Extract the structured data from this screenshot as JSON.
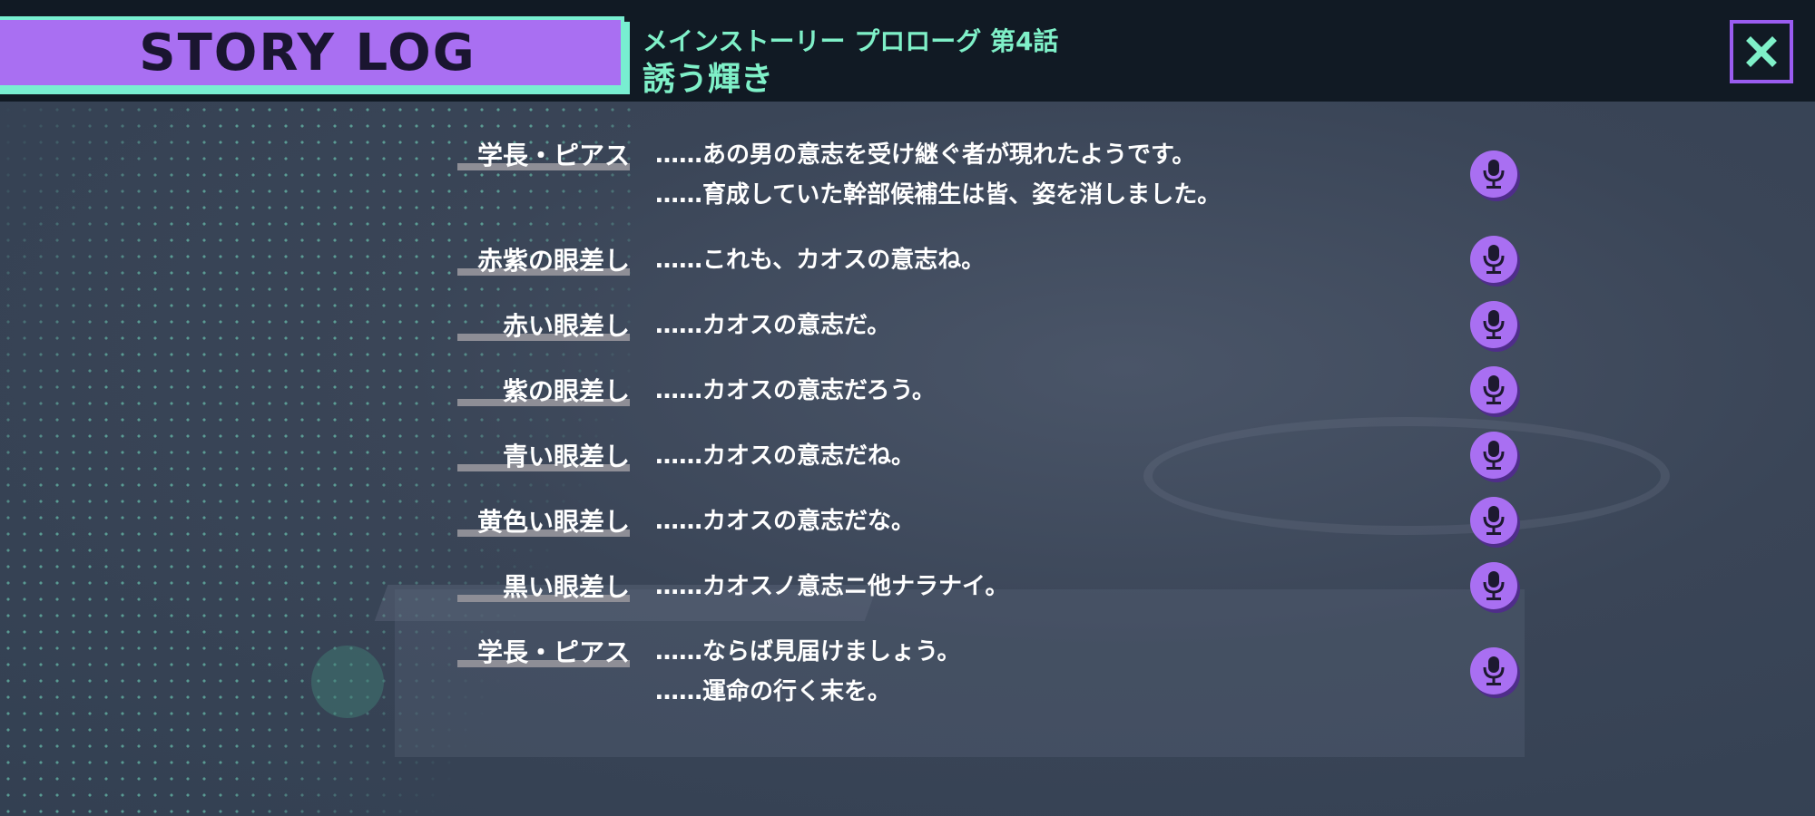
{
  "header": {
    "title": "STORY LOG",
    "subtitle": "メインストーリー プロローグ 第4話",
    "episode": "誘う輝き",
    "close_icon": "close-icon"
  },
  "colors": {
    "accent_purple": "#a96ff2",
    "accent_mint": "#78eed1",
    "header_bg": "#111a24"
  },
  "log": [
    {
      "speaker": "学長・ピアス",
      "lines": [
        "……あの男の意志を受け継ぐ者が現れたようです。",
        "……育成していた幹部候補生は皆、姿を消しました。"
      ],
      "icon": "microphone-icon"
    },
    {
      "speaker": "赤紫の眼差し",
      "lines": [
        "……これも、カオスの意志ね。"
      ],
      "icon": "microphone-icon"
    },
    {
      "speaker": "赤い眼差し",
      "lines": [
        "……カオスの意志だ。"
      ],
      "icon": "microphone-icon"
    },
    {
      "speaker": "紫の眼差し",
      "lines": [
        "……カオスの意志だろう。"
      ],
      "icon": "microphone-icon"
    },
    {
      "speaker": "青い眼差し",
      "lines": [
        "……カオスの意志だね。"
      ],
      "icon": "microphone-icon"
    },
    {
      "speaker": "黄色い眼差し",
      "lines": [
        "……カオスの意志だな。"
      ],
      "icon": "microphone-icon"
    },
    {
      "speaker": "黒い眼差し",
      "lines": [
        "……カオスノ意志ニ他ナラナイ。"
      ],
      "icon": "microphone-icon"
    },
    {
      "speaker": "学長・ピアス",
      "lines": [
        "……ならば見届けましょう。",
        "……運命の行く末を。"
      ],
      "icon": "microphone-icon"
    }
  ]
}
